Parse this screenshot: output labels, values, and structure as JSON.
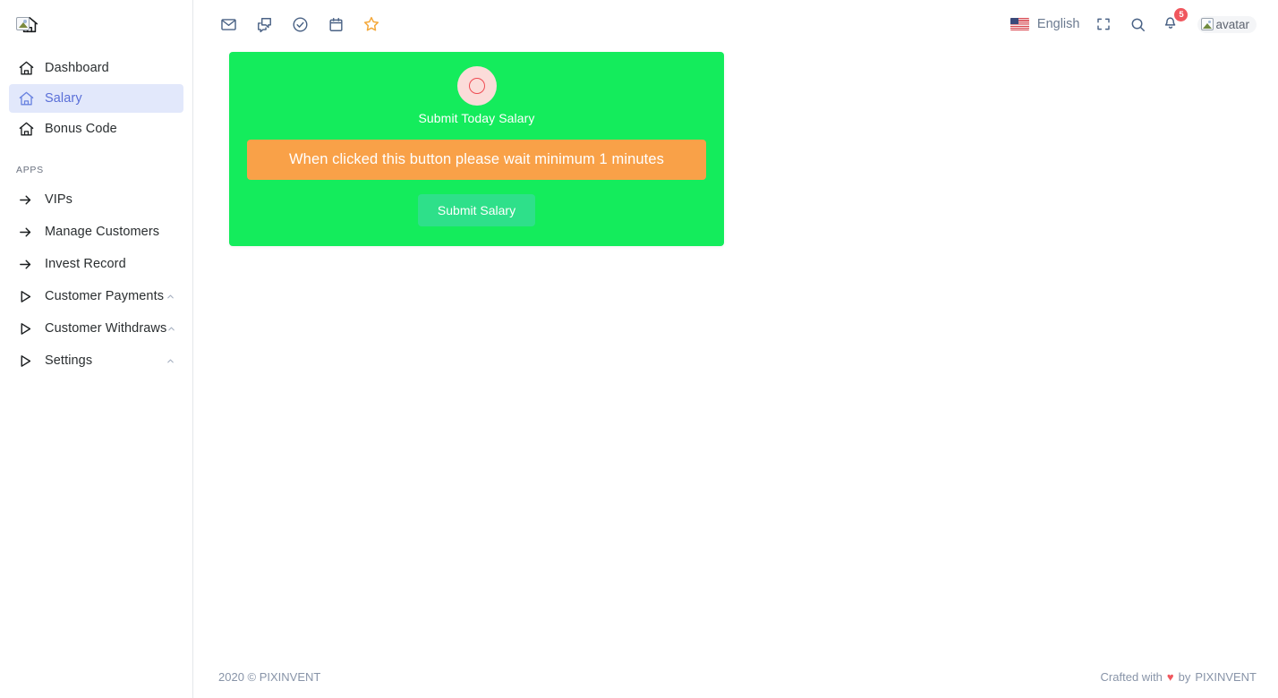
{
  "brand": {
    "logo_icon": "home-icon",
    "broken_logo_alt": ""
  },
  "sidebar": {
    "main_items": [
      {
        "label": "Dashboard",
        "icon": "home-icon",
        "active": false
      },
      {
        "label": "Salary",
        "icon": "home-icon",
        "active": true
      },
      {
        "label": "Bonus Code",
        "icon": "home-icon",
        "active": false
      }
    ],
    "section_label": "APPS",
    "app_items": [
      {
        "label": "VIPs",
        "icon": "arrow-right-icon",
        "chevron": ""
      },
      {
        "label": "Manage Customers",
        "icon": "arrow-right-icon",
        "chevron": ""
      },
      {
        "label": "Invest Record",
        "icon": "arrow-right-icon",
        "chevron": ""
      },
      {
        "label": "Customer Payments",
        "icon": "play-triangle-icon",
        "chevron": "chevron-up-icon"
      },
      {
        "label": "Customer Withdraws",
        "icon": "play-triangle-icon",
        "chevron": "chevron-up-icon"
      },
      {
        "label": "Settings",
        "icon": "play-triangle-icon",
        "chevron": "chevron-up-icon"
      }
    ]
  },
  "navbar": {
    "left_icons": [
      {
        "name": "mail-icon"
      },
      {
        "name": "chat-icon"
      },
      {
        "name": "check-circle-icon"
      },
      {
        "name": "calendar-icon"
      },
      {
        "name": "star-icon"
      }
    ],
    "language": "English",
    "language_flag": "us-flag-icon",
    "fullscreen_icon": "fullscreen-icon",
    "search_icon": "search-icon",
    "notification_icon": "bell-icon",
    "notification_count": "5",
    "avatar_alt": "avatar"
  },
  "card": {
    "avatar_icon": "circle-ring-icon",
    "title": "Submit Today Salary",
    "warning_label": "When clicked this button please wait minimum 1 minutes",
    "submit_label": "Submit Salary"
  },
  "footer": {
    "copyright": "2020 © PIXINVENT",
    "crafted_prefix": "Crafted with",
    "heart": "♥",
    "crafted_suffix": "by",
    "brand": "PIXINVENT"
  },
  "colors": {
    "card_green": "#14ec5c",
    "warning_orange": "#f9a148",
    "submit_green": "#2ee08a",
    "active_nav_bg": "#e2e8fb",
    "active_nav_text": "#5a6fd8",
    "badge_red": "#f0575e",
    "star_orange": "#f4a83a"
  }
}
